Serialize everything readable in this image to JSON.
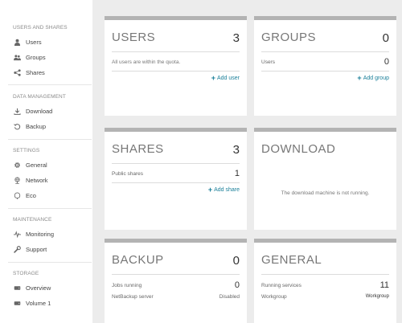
{
  "sidebar": {
    "sections": [
      {
        "title": "USERS AND SHARES",
        "items": [
          {
            "label": "Users",
            "icon": "user-icon"
          },
          {
            "label": "Groups",
            "icon": "group-icon"
          },
          {
            "label": "Shares",
            "icon": "share-icon"
          }
        ]
      },
      {
        "title": "DATA MANAGEMENT",
        "items": [
          {
            "label": "Download",
            "icon": "download-icon"
          },
          {
            "label": "Backup",
            "icon": "backup-icon"
          }
        ]
      },
      {
        "title": "SETTINGS",
        "items": [
          {
            "label": "General",
            "icon": "gear-icon"
          },
          {
            "label": "Network",
            "icon": "network-icon"
          },
          {
            "label": "Eco",
            "icon": "eco-icon"
          }
        ]
      },
      {
        "title": "MAINTENANCE",
        "items": [
          {
            "label": "Monitoring",
            "icon": "pulse-icon"
          },
          {
            "label": "Support",
            "icon": "wrench-icon"
          }
        ]
      },
      {
        "title": "STORAGE",
        "items": [
          {
            "label": "Overview",
            "icon": "drive-icon"
          },
          {
            "label": "Volume 1",
            "icon": "drive-icon"
          }
        ]
      }
    ]
  },
  "cards": {
    "users": {
      "title": "USERS",
      "count": "3",
      "note": "All users are within the quota.",
      "action": "Add user"
    },
    "groups": {
      "title": "GROUPS",
      "count": "0",
      "row_label": "Users",
      "row_value": "0",
      "action": "Add group"
    },
    "shares": {
      "title": "SHARES",
      "count": "3",
      "row_label": "Public shares",
      "row_value": "1",
      "action": "Add share"
    },
    "download": {
      "title": "DOWNLOAD",
      "message": "The download machine is not running."
    },
    "backup": {
      "title": "BACKUP",
      "count": "0",
      "row1_label": "Jobs running",
      "row1_value": "0",
      "row2_label": "NetBackup server",
      "row2_value": "Disabled"
    },
    "general": {
      "title": "GENERAL",
      "row1_label": "Running services",
      "row1_value": "11",
      "row2_label": "Workgroup",
      "row2_value": "Workgroup"
    }
  },
  "colors": {
    "accent": "#1a7f99",
    "card_header": "#b3b3b3",
    "main_bg": "#ececec"
  }
}
